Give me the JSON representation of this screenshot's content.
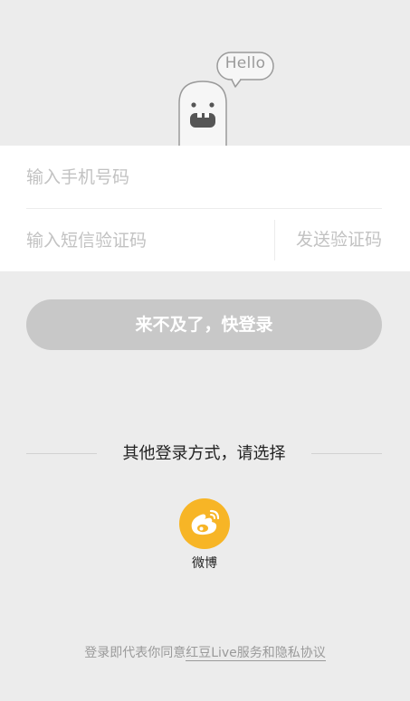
{
  "mascot": {
    "bubble_text": "Hello"
  },
  "form": {
    "phone_placeholder": "输入手机号码",
    "code_placeholder": "输入短信验证码",
    "send_code_label": "发送验证码"
  },
  "login_button_label": "来不及了，快登录",
  "other_login": {
    "divider_label": "其他登录方式，请选择",
    "weibo_label": "微博",
    "weibo_icon": "weibo-icon"
  },
  "agreement": {
    "prefix": "登录即代表你同意",
    "link": "红豆Live服务和隐私协议"
  },
  "colors": {
    "background": "#ececec",
    "card": "#ffffff",
    "button_disabled": "#c8c8c8",
    "weibo": "#f7b526",
    "placeholder": "#c2c2c2"
  }
}
